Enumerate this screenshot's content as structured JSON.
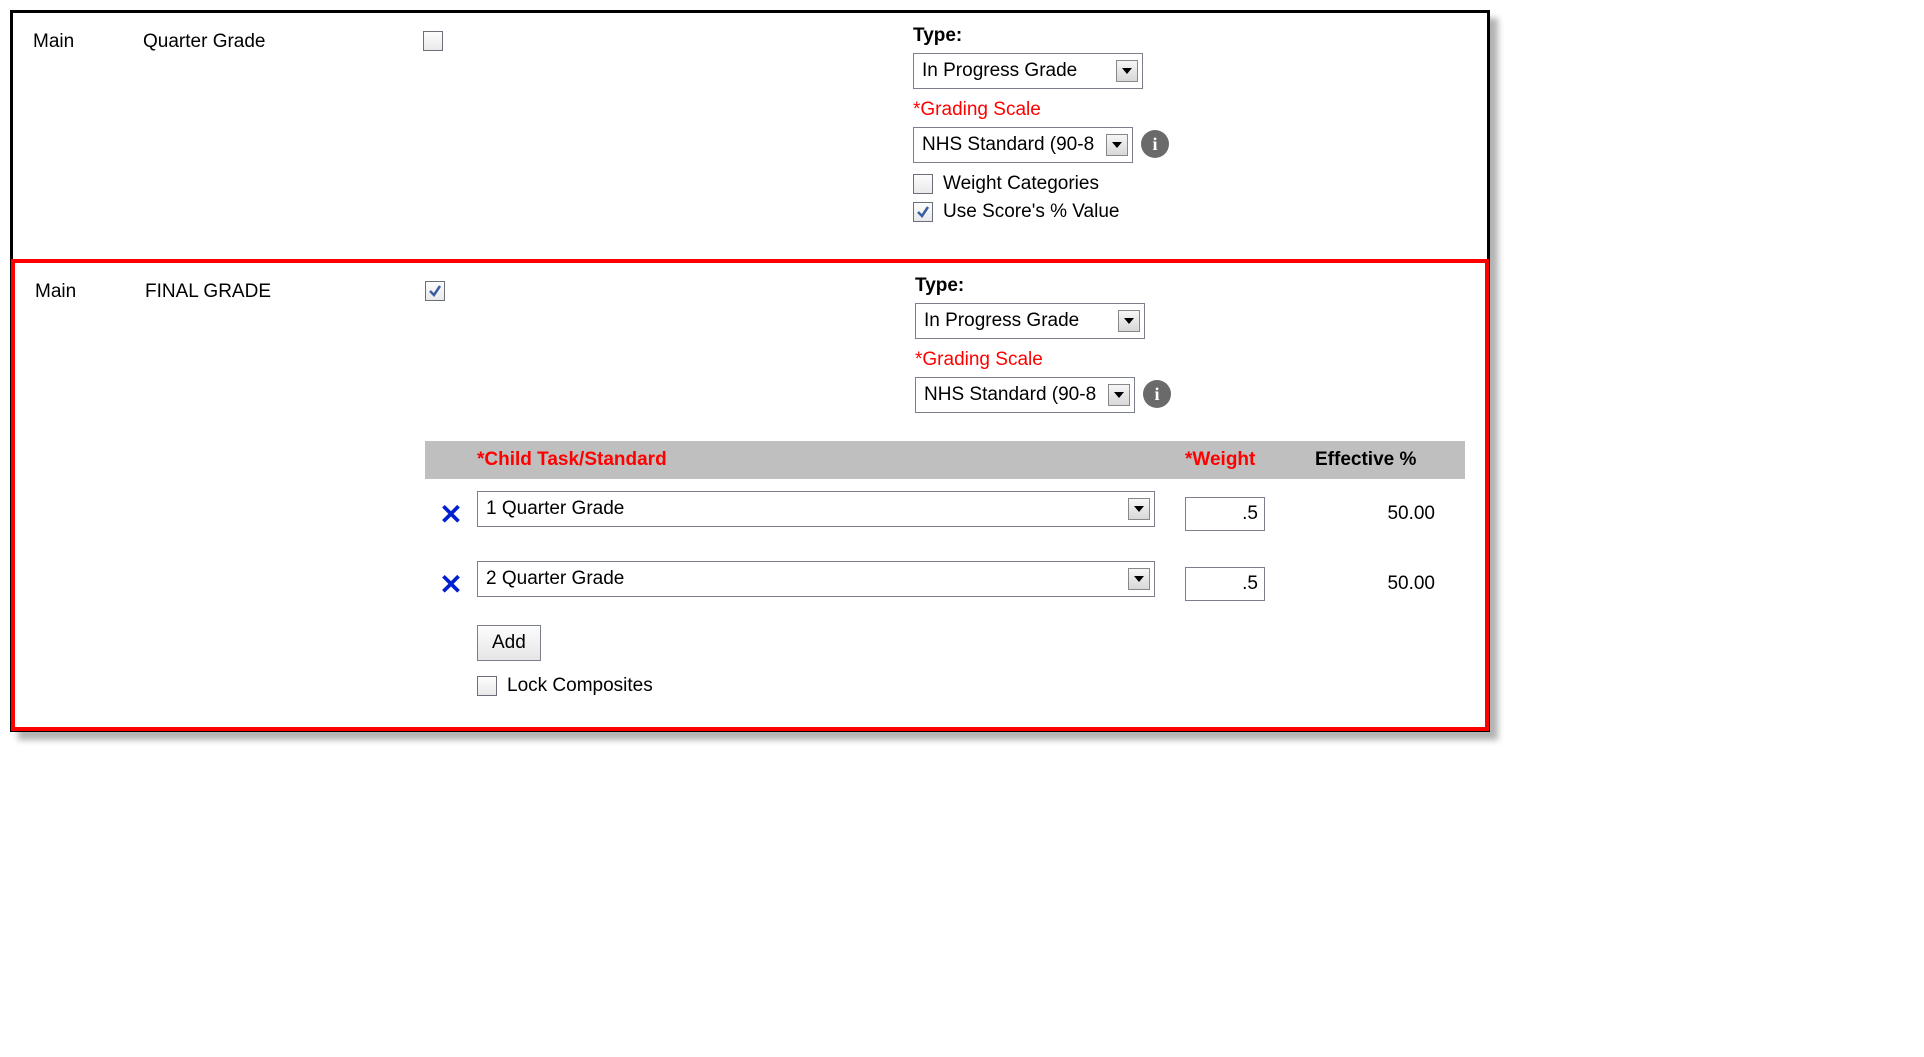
{
  "rows": [
    {
      "group": "Main",
      "task": "Quarter Grade",
      "composite_checked": false,
      "settings": {
        "type_label": "Type:",
        "type_value": "In Progress Grade",
        "scale_label": "*Grading Scale",
        "scale_value": "NHS Standard (90-8",
        "weight_categories": {
          "label": "Weight Categories",
          "checked": false
        },
        "use_percent": {
          "label": "Use Score's % Value",
          "checked": true
        }
      }
    },
    {
      "group": "Main",
      "task": "FINAL GRADE",
      "composite_checked": true,
      "settings": {
        "type_label": "Type:",
        "type_value": "In Progress Grade",
        "scale_label": "*Grading Scale",
        "scale_value": "NHS Standard (90-8"
      },
      "child_table": {
        "header_task": "*Child Task/Standard",
        "header_weight": "*Weight",
        "header_eff": "Effective %",
        "rows": [
          {
            "task": "1 Quarter Grade",
            "weight": ".5",
            "effective": "50.00"
          },
          {
            "task": "2 Quarter Grade",
            "weight": ".5",
            "effective": "50.00"
          }
        ],
        "add_label": "Add",
        "lock_label": "Lock Composites",
        "lock_checked": false
      }
    }
  ]
}
